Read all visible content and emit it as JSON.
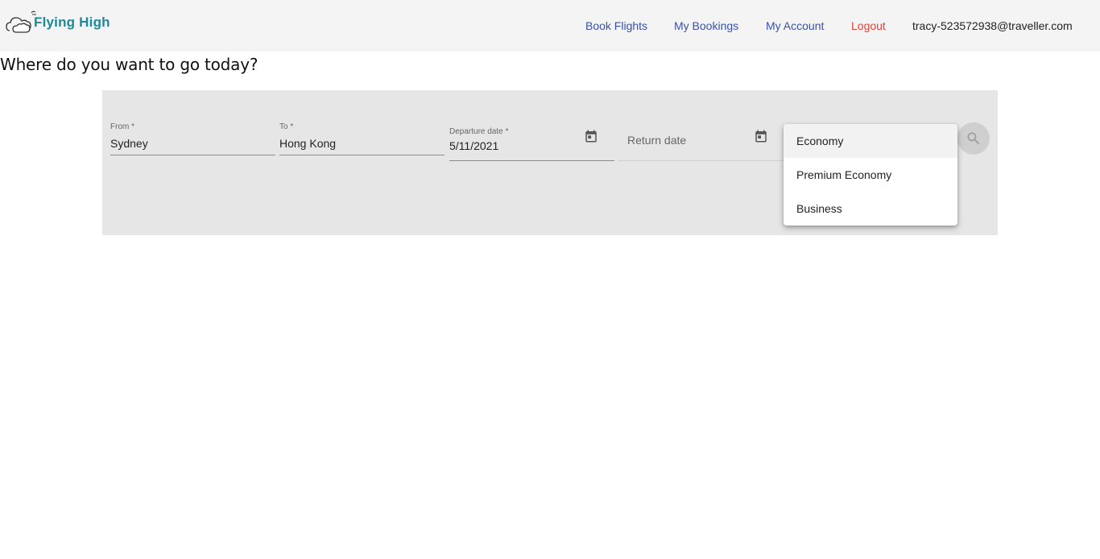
{
  "header": {
    "logo_text": "Flying High",
    "nav": {
      "book_flights": "Book Flights",
      "my_bookings": "My Bookings",
      "my_account": "My Account",
      "logout": "Logout"
    },
    "user_email": "tracy-523572938@traveller.com"
  },
  "main": {
    "title": "Where do you want to go today?"
  },
  "search": {
    "from": {
      "label": "From *",
      "value": "Sydney"
    },
    "to": {
      "label": "To *",
      "value": "Hong Kong"
    },
    "departure": {
      "label": "Departure date *",
      "value": "5/11/2021",
      "icon": "calendar-icon"
    },
    "return": {
      "placeholder": "Return date",
      "icon": "calendar-icon"
    },
    "search_icon": "search-icon"
  },
  "cabin_class_dropdown": {
    "options": [
      "Economy",
      "Premium Economy",
      "Business"
    ],
    "selected": "Economy"
  },
  "colors": {
    "header_bg": "#f4f4f4",
    "nav_link": "#3a51a8",
    "logout": "#e0453a",
    "logo": "#1a8a99",
    "panel_bg": "#e6e6e6"
  }
}
